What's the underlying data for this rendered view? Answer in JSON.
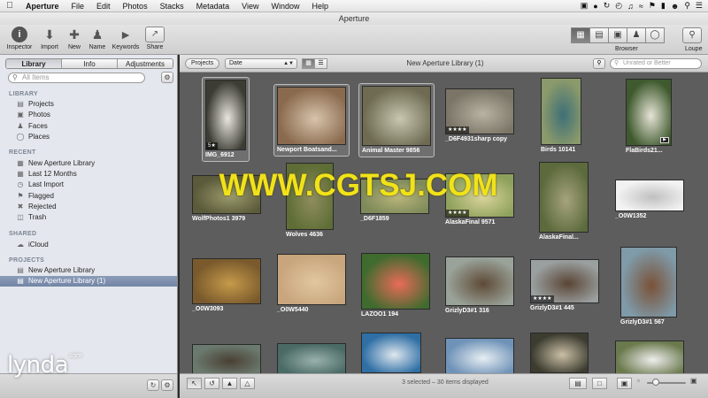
{
  "menubar": {
    "items": [
      "Aperture",
      "File",
      "Edit",
      "Photos",
      "Stacks",
      "Metadata",
      "View",
      "Window",
      "Help"
    ],
    "status": {
      "battery": "battery-icon",
      "wifi": "wifi-icon",
      "clock": "time-machine-icon"
    }
  },
  "window": {
    "title": "Aperture"
  },
  "toolbar": {
    "inspector": "Inspector",
    "import": "Import",
    "new": "New",
    "name": "Name",
    "keywords": "Keywords",
    "share": "Share",
    "browser": "Browser",
    "loupe": "Loupe"
  },
  "sidebar": {
    "tabs": [
      "Library",
      "Info",
      "Adjustments"
    ],
    "search_placeholder": "All Items",
    "sections": {
      "library": "LIBRARY",
      "recent": "RECENT",
      "shared": "SHARED",
      "projects": "PROJECTS"
    },
    "library_items": [
      "Projects",
      "Photos",
      "Faces",
      "Places"
    ],
    "recent_items": [
      "New Aperture Library",
      "Last 12 Months",
      "Last Import",
      "Flagged",
      "Rejected",
      "Trash"
    ],
    "shared_items": [
      "iCloud"
    ],
    "project_items": [
      "New Aperture Library",
      "New Aperture Library (1)"
    ]
  },
  "browser": {
    "projects_button": "Projects",
    "sort": "Date",
    "title": "New Aperture Library (1)",
    "filter_placeholder": "Unrated or Better",
    "status": "3 selected – 30 items displayed"
  },
  "thumbs": [
    {
      "caption": "IMG_6912",
      "stars": "5★",
      "selected": true,
      "color": "#3c3c34",
      "color2": "#e8e6df"
    },
    {
      "caption": "Newport Boatsand...",
      "stars": "",
      "selected": true,
      "color": "#8a6a4e",
      "color2": "#d7c4ab"
    },
    {
      "caption": "Animal Master  9856",
      "stars": "",
      "selected": true,
      "color": "#6e6b52",
      "color2": "#c9c6b1"
    },
    {
      "caption": "_D6F4931sharp copy",
      "stars": "★★★★",
      "selected": false,
      "color": "#7a7566",
      "color2": "#b9b3a3"
    },
    {
      "caption": "Birds  10141",
      "stars": "",
      "selected": false,
      "color": "#8b9a6a",
      "color2": "#3e6f78"
    },
    {
      "caption": "FlaBirds21...",
      "stars": "",
      "selected": false,
      "color": "#3f5a2e",
      "color2": "#e6e3d6"
    },
    {
      "caption": "WolfPhotos1  3979",
      "stars": "",
      "selected": false,
      "color": "#5b5a3a",
      "color2": "#9a9a6c"
    },
    {
      "caption": "Wolves  4636",
      "stars": "",
      "selected": false,
      "color": "#5e6d36",
      "color2": "#8f8d5e"
    },
    {
      "caption": "_D6F1859",
      "stars": "",
      "selected": false,
      "color": "#7e8a5a",
      "color2": "#b8b47a"
    },
    {
      "caption": "AlaskaFinal  9571",
      "stars": "★★★★",
      "selected": false,
      "color": "#8ea15c",
      "color2": "#d9d49a"
    },
    {
      "caption": "AlaskaFinal...",
      "stars": "",
      "selected": false,
      "color": "#5c6a3c",
      "color2": "#a6a37d"
    },
    {
      "caption": "_O0W1352",
      "stars": "",
      "selected": false,
      "color": "#f2f2f2",
      "color2": "#c0c0c0"
    },
    {
      "caption": "_O0W3093",
      "stars": "",
      "selected": false,
      "color": "#7a5a2c",
      "color2": "#c59a4a"
    },
    {
      "caption": "_O0W5440",
      "stars": "",
      "selected": false,
      "color": "#c8a57c",
      "color2": "#e1c79f"
    },
    {
      "caption": "LAZOO1  194",
      "stars": "",
      "selected": false,
      "color": "#3f6b2e",
      "color2": "#e96b58"
    },
    {
      "caption": "GrizlyD3#1  316",
      "stars": "",
      "selected": false,
      "color": "#9aa39a",
      "color2": "#5e4a36"
    },
    {
      "caption": "GrizlyD3#1  445",
      "stars": "★★★★",
      "selected": false,
      "color": "#9aa0a0",
      "color2": "#5a4535"
    },
    {
      "caption": "GrizlyD3#1  567",
      "stars": "",
      "selected": false,
      "color": "#7f9aa8",
      "color2": "#7a5238"
    },
    {
      "caption": "",
      "stars": "",
      "selected": false,
      "color": "#6b7a6e",
      "color2": "#4a3f33"
    },
    {
      "caption": "",
      "stars": "",
      "selected": false,
      "color": "#4a6a66",
      "color2": "#9ab1aa"
    },
    {
      "caption": "",
      "stars": "",
      "selected": false,
      "color": "#2f6fa5",
      "color2": "#dfe7ee"
    },
    {
      "caption": "",
      "stars": "",
      "selected": false,
      "color": "#6f93b8",
      "color2": "#e8eef3"
    },
    {
      "caption": "",
      "stars": "",
      "selected": false,
      "color": "#3c3c30",
      "color2": "#cbbfa5"
    },
    {
      "caption": "",
      "stars": "",
      "selected": false,
      "color": "#6b7a4d",
      "color2": "#eeeeee"
    }
  ],
  "watermark": "WWW.CGTSJ.COM",
  "brand": "lynda",
  "brand_suffix": ".com"
}
